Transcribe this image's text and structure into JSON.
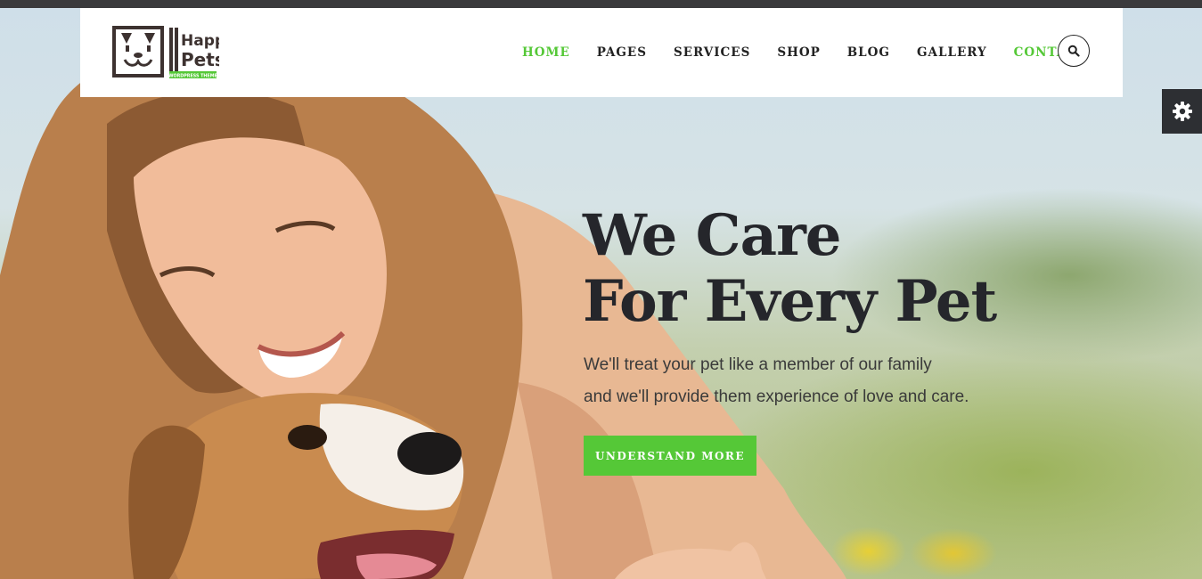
{
  "brand": {
    "name_line1": "Happy",
    "name_line2": "Pets",
    "tagline": "WORDPRESS THEME"
  },
  "nav": {
    "items": [
      {
        "label": "HOME",
        "active": true
      },
      {
        "label": "PAGES"
      },
      {
        "label": "SERVICES"
      },
      {
        "label": "SHOP"
      },
      {
        "label": "BLOG"
      },
      {
        "label": "GALLERY"
      },
      {
        "label": "CONTACT",
        "highlight": true
      }
    ]
  },
  "hero": {
    "title_line1": "We Care",
    "title_line2": "For Every Pet",
    "subtitle_line1": "We'll treat your pet like a member of our family",
    "subtitle_line2": "and we'll provide them experience of love and care.",
    "cta_label": "UNDERSTAND MORE"
  },
  "icons": {
    "search": "search-icon",
    "settings": "gear-icon"
  },
  "colors": {
    "accent": "#55c837",
    "text_dark": "#25262b",
    "settings_tab": "#2d2f33"
  }
}
